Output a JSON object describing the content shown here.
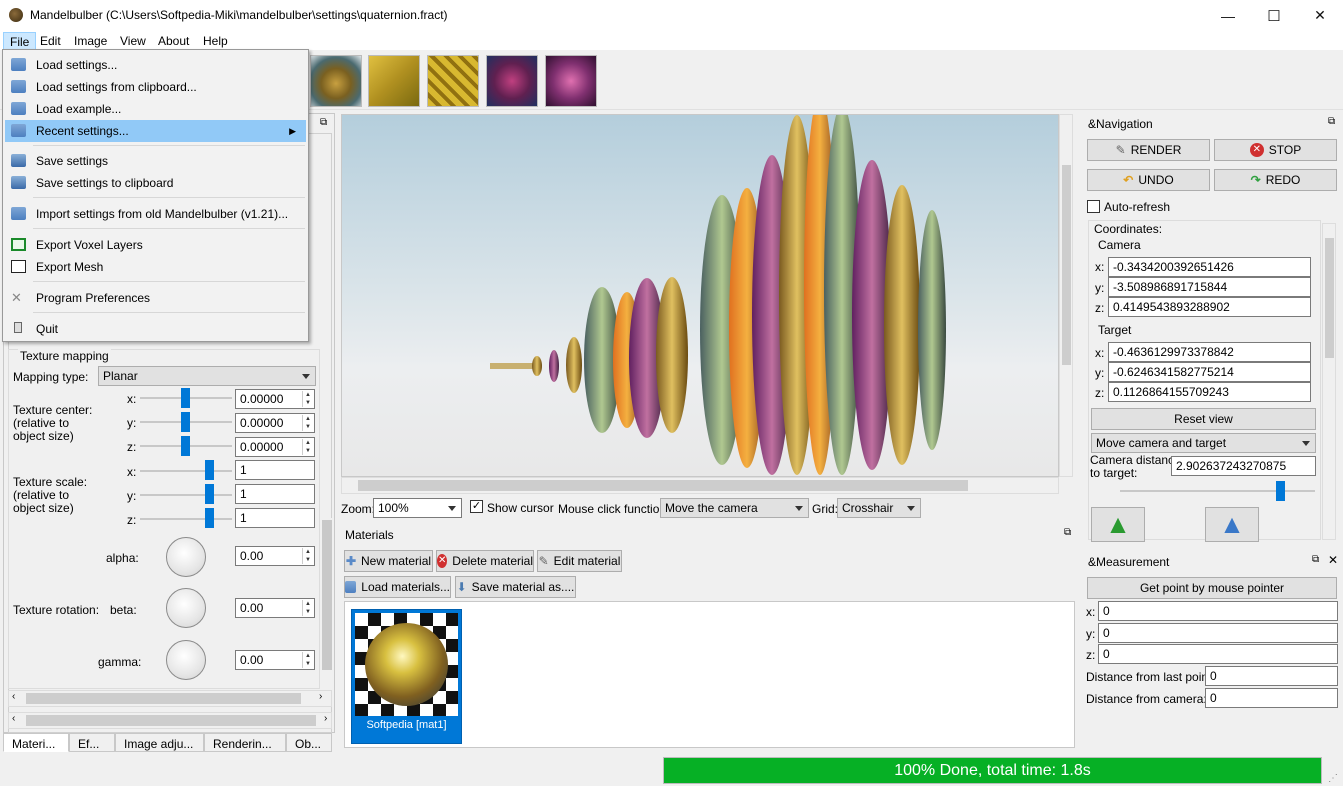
{
  "window": {
    "title": "Mandelbulber (C:\\Users\\Softpedia-Miki\\mandelbulber\\settings\\quaternion.fract)",
    "minimize": "—",
    "maximize": "☐",
    "close": "✕"
  },
  "menubar": {
    "items": [
      "File",
      "Edit",
      "Image",
      "View",
      "About",
      "Help"
    ]
  },
  "file_menu": {
    "items": [
      {
        "label": "Load settings...",
        "icon": "folder-icon"
      },
      {
        "label": "Load settings from clipboard...",
        "icon": "folder-icon"
      },
      {
        "label": "Load example...",
        "icon": "folder-icon"
      },
      {
        "label": "Recent settings...",
        "icon": "folder-icon",
        "submenu_arrow": "▶"
      },
      {
        "label": "Save settings",
        "icon": "save-icon"
      },
      {
        "label": "Save settings to clipboard",
        "icon": "save-icon"
      },
      {
        "label": "Import settings from old Mandelbulber (v1.21)...",
        "icon": "folder-icon"
      },
      {
        "label": "Export Voxel Layers",
        "icon": "voxel-icon"
      },
      {
        "label": "Export Mesh",
        "icon": "mesh-icon"
      },
      {
        "label": "Program Preferences",
        "icon": "preferences-icon"
      },
      {
        "label": "Quit",
        "icon": "quit-icon"
      }
    ]
  },
  "texture_mapping": {
    "group_title": "Texture mapping",
    "mapping_type_label": "Mapping type:",
    "mapping_type_value": "Planar",
    "center_label": "Texture center:\n(relative to\nobject size)",
    "scale_label": "Texture scale:\n(relative to\nobject size)",
    "rotation_label": "Texture rotation:",
    "axes": [
      "x:",
      "y:",
      "z:"
    ],
    "center_values": [
      "0.00000",
      "0.00000",
      "0.00000"
    ],
    "scale_values": [
      "1",
      "1",
      "1"
    ],
    "rotation": [
      {
        "label": "alpha:",
        "value": "0.00"
      },
      {
        "label": "beta:",
        "value": "0.00"
      },
      {
        "label": "gamma:",
        "value": "0.00"
      }
    ]
  },
  "left_tabs": [
    "Materi...",
    "Ef...",
    "Image adju...",
    "Renderin...",
    "Ob..."
  ],
  "render_bar": {
    "zoom_label": "Zoom:",
    "zoom_value": "100%",
    "show_cursor": "Show cursor",
    "mouse_click_label": "Mouse click function:",
    "mouse_click_value": "Move the camera",
    "grid_label": "Grid:",
    "grid_value": "Crosshair"
  },
  "materials": {
    "title": "Materials",
    "new": "New material",
    "delete": "Delete material",
    "edit": "Edit material",
    "load": "Load materials...",
    "save": "Save material as....",
    "items": [
      {
        "label": "Softpedia [mat1]"
      }
    ]
  },
  "navigation": {
    "title": "&Navigation",
    "render": "RENDER",
    "stop": "STOP",
    "undo": "UNDO",
    "redo": "REDO",
    "auto_refresh": "Auto-refresh",
    "coordinates_label": "Coordinates:",
    "camera_label": "Camera",
    "camera": {
      "x": "-0.3434200392651426",
      "y": "-3.508986891715844",
      "z": "0.4149543893288902"
    },
    "target_label": "Target",
    "target": {
      "x": "-0.4636129973378842",
      "y": "-0.6246341582775214",
      "z": "0.1126864155709243"
    },
    "axes": [
      "x:",
      "y:",
      "z:"
    ],
    "reset_view": "Reset view",
    "move_mode": "Move camera and target",
    "distance_label": "Camera distance\nto target:",
    "distance_value": "2.902637243270875"
  },
  "measurement": {
    "title": "&Measurement",
    "get_point": "Get point by mouse pointer",
    "x_label": "x:",
    "x": "0",
    "y_label": "y:",
    "y": "0",
    "z_label": "z:",
    "z": "0",
    "dist_last_label": "Distance from last point:",
    "dist_last": "0",
    "dist_camera_label": "Distance from camera:",
    "dist_camera": "0"
  },
  "status": {
    "progress_text": "100% Done, total time: 1.8s",
    "progress": 1.0
  },
  "colors": {
    "accent": "#0078d7",
    "progress_green": "#06b025",
    "menu_highlight": "#91c9f7"
  }
}
